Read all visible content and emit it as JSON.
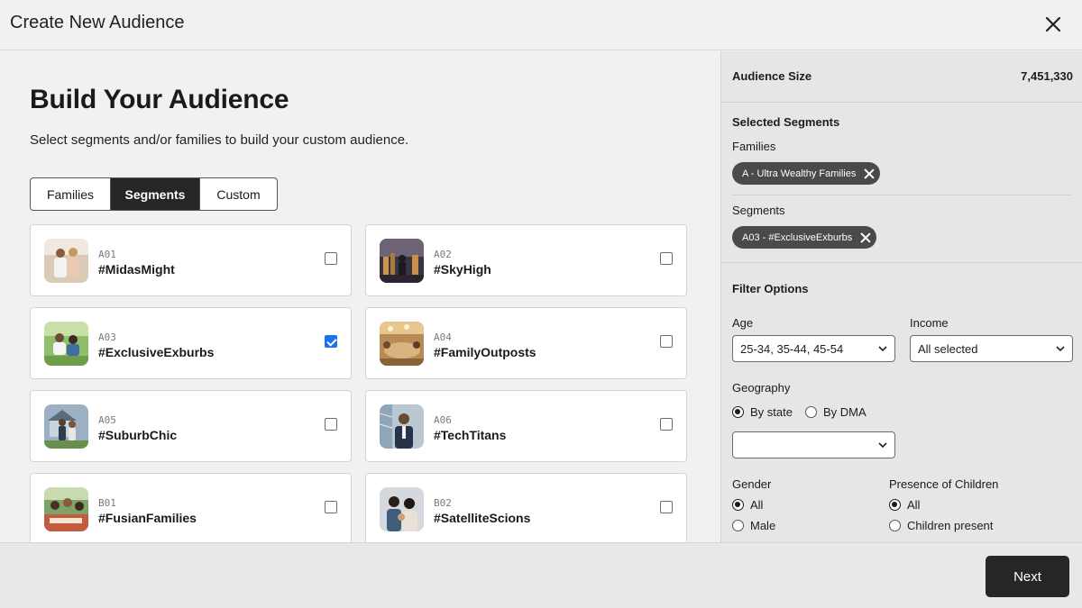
{
  "header": {
    "title": "Create New Audience",
    "close_icon": "close-icon"
  },
  "main": {
    "heading": "Build Your Audience",
    "subheading": "Select segments and/or families to build your custom audience.",
    "tabs": [
      {
        "label": "Families",
        "active": false
      },
      {
        "label": "Segments",
        "active": true
      },
      {
        "label": "Custom",
        "active": false
      }
    ],
    "cards": [
      {
        "code": "A01",
        "name": "#MidasMight",
        "checked": false
      },
      {
        "code": "A02",
        "name": "#SkyHigh",
        "checked": false
      },
      {
        "code": "A03",
        "name": "#ExclusiveExburbs",
        "checked": true
      },
      {
        "code": "A04",
        "name": "#FamilyOutposts",
        "checked": false
      },
      {
        "code": "A05",
        "name": "#SuburbChic",
        "checked": false
      },
      {
        "code": "A06",
        "name": "#TechTitans",
        "checked": false
      },
      {
        "code": "B01",
        "name": "#FusianFamilies",
        "checked": false
      },
      {
        "code": "B02",
        "name": "#SatelliteScions",
        "checked": false
      }
    ]
  },
  "sidebar": {
    "audience_size_label": "Audience Size",
    "audience_size_value": "7,451,330",
    "selected_title": "Selected Segments",
    "families_label": "Families",
    "families_chip": "A - Ultra Wealthy Families",
    "segments_label": "Segments",
    "segments_chip": "A03 - #ExclusiveExburbs",
    "filter_title": "Filter Options",
    "age_label": "Age",
    "age_value": "25-34, 35-44, 45-54",
    "income_label": "Income",
    "income_value": "All selected",
    "geo_label": "Geography",
    "geo_by_state": "By state",
    "geo_by_dma": "By DMA",
    "geo_selected": "By state",
    "geo_select_value": "",
    "gender_label": "Gender",
    "gender_options": [
      "All",
      "Male"
    ],
    "gender_selected": "All",
    "children_label": "Presence of Children",
    "children_options": [
      "All",
      "Children present"
    ],
    "children_selected": "All"
  },
  "footer": {
    "next_label": "Next"
  },
  "colors": {
    "accent_dark": "#262626",
    "checkbox_blue": "#1a73e8",
    "chip_bg": "#4a4a4a"
  }
}
